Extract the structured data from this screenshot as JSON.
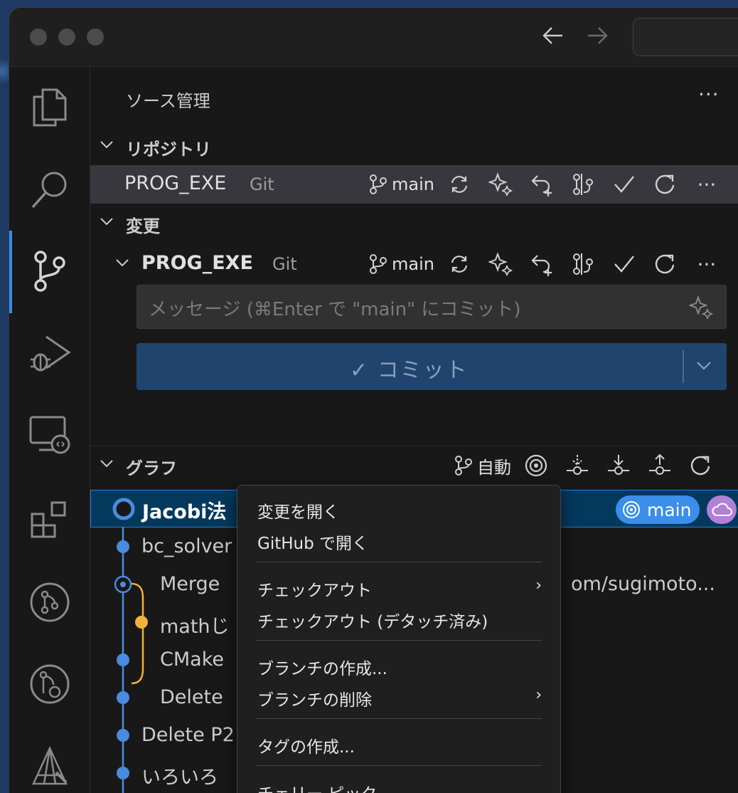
{
  "titlebar": {
    "back_icon": "arrow-left-icon",
    "forward_icon": "arrow-right-icon"
  },
  "view": {
    "title": "ソース管理",
    "more": "···"
  },
  "repositories": {
    "section_label": "リポジトリ",
    "repo": {
      "name": "PROG_EXE",
      "type": "Git",
      "branch": "main"
    }
  },
  "changes": {
    "section_label": "変更",
    "repo": {
      "name": "PROG_EXE",
      "type": "Git",
      "branch": "main"
    },
    "message_placeholder": "メッセージ (⌘Enter で \"main\" にコミット)",
    "commit_label": "✓ コミット"
  },
  "graph": {
    "section_label": "グラフ",
    "mode_label": "自動",
    "rows": [
      {
        "text": "Jacobi法",
        "bold": true
      },
      {
        "text": "bc_solver"
      },
      {
        "text": "Merge",
        "right_text": "om/sugimoto..."
      },
      {
        "text": "mathじ"
      },
      {
        "text": "CMake"
      },
      {
        "text": "Delete"
      },
      {
        "text": "Delete P2"
      },
      {
        "text": "いろいろ"
      }
    ],
    "badge_main": "main"
  },
  "context_menu": {
    "items": [
      {
        "label": "変更を開く"
      },
      {
        "label": "GitHub で開く"
      },
      {
        "label": "チェックアウト",
        "submenu": true
      },
      {
        "label": "チェックアウト (デタッチ済み)"
      },
      {
        "label": "ブランチの作成..."
      },
      {
        "label": "ブランチの削除",
        "submenu": true
      },
      {
        "label": "タグの作成..."
      },
      {
        "label": "チェリー ピック"
      }
    ],
    "submenu_indicator": "›"
  },
  "colors": {
    "accent": "#3b8eea",
    "branch_orange": "#f0b33a",
    "selection": "#04395e",
    "cloud_badge": "#b180d7"
  }
}
